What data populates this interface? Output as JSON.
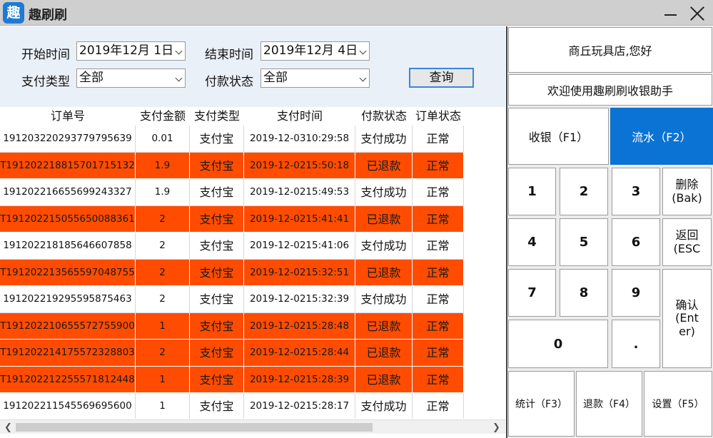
{
  "window": {
    "logo": "趣",
    "title": "趣刷刷"
  },
  "filters": {
    "start_label": "开始时间",
    "start_value": "2019年12月  1日",
    "end_label": "结束时间",
    "end_value": "2019年12月  4日",
    "paytype_label": "支付类型",
    "paytype_value": "全部",
    "paystatus_label": "付款状态",
    "paystatus_value": "全部",
    "query_label": "查询"
  },
  "table": {
    "headers": [
      "订单号",
      "支付金额",
      "支付类型",
      "支付时间",
      "付款状态",
      "订单状态"
    ],
    "rows": [
      {
        "id": "1912032202937797956​39",
        "amount": "0.01",
        "type": "支付宝",
        "time": "2019-12-03 10:29:58",
        "paystatus": "支付成功",
        "orderstatus": "正常",
        "refund": false
      },
      {
        "id": "T19120221881570171513 2",
        "amount": "1.9",
        "type": "支付宝",
        "time": "2019-12-02 15:50:18",
        "paystatus": "已退款",
        "orderstatus": "正常",
        "refund": true
      },
      {
        "id": "1912022166556992433 27",
        "amount": "1.9",
        "type": "支付宝",
        "time": "2019-12-02 15:49:53",
        "paystatus": "支付成功",
        "orderstatus": "正常",
        "refund": false
      },
      {
        "id": "T19120221505565008836 1",
        "amount": "2",
        "type": "支付宝",
        "time": "2019-12-02 15:41:41",
        "paystatus": "已退款",
        "orderstatus": "正常",
        "refund": true
      },
      {
        "id": "1912022181856466078 58",
        "amount": "2",
        "type": "支付宝",
        "time": "2019-12-02 15:41:06",
        "paystatus": "支付成功",
        "orderstatus": "正常",
        "refund": false
      },
      {
        "id": "T19120221356559704875 5",
        "amount": "2",
        "type": "支付宝",
        "time": "2019-12-02 15:32:51",
        "paystatus": "已退款",
        "orderstatus": "正常",
        "refund": true
      },
      {
        "id": "1912022192955958754 63",
        "amount": "2",
        "type": "支付宝",
        "time": "2019-12-02 15:32:39",
        "paystatus": "支付成功",
        "orderstatus": "正常",
        "refund": false
      },
      {
        "id": "T19120221065557275590 0",
        "amount": "1",
        "type": "支付宝",
        "time": "2019-12-02 15:28:48",
        "paystatus": "已退款",
        "orderstatus": "正常",
        "refund": true
      },
      {
        "id": "T19120221417557232880 3",
        "amount": "2",
        "type": "支付宝",
        "time": "2019-12-02 15:28:44",
        "paystatus": "已退款",
        "orderstatus": "正常",
        "refund": true
      },
      {
        "id": "T19120221225557181244 8",
        "amount": "1",
        "type": "支付宝",
        "time": "2019-12-02 15:28:39",
        "paystatus": "已退款",
        "orderstatus": "正常",
        "refund": true
      },
      {
        "id": "1912022115455696956 00",
        "amount": "1",
        "type": "支付宝",
        "time": "2019-12-02 15:28:17",
        "paystatus": "支付成功",
        "orderstatus": "正常",
        "refund": false
      }
    ]
  },
  "panel": {
    "greeting": "商丘玩具店,您好",
    "welcome": "欢迎使用趣刷刷收银助手",
    "tab_cashier": "收银（F1）",
    "tab_flow": "流水（F2）",
    "keys": [
      "1",
      "2",
      "3",
      "4",
      "5",
      "6",
      "7",
      "8",
      "9",
      "0",
      "."
    ],
    "delete_key": "删除\n(Bak)",
    "back_key": "返回\n(ESC",
    "confirm_key": "确认\n(Ent\ner)",
    "stats_btn": "统计（F3）",
    "refund_btn": "退款（F4）",
    "settings_btn": "设置（F5）"
  },
  "colors": {
    "refund_row": "#ff4c00",
    "accent": "#0a73d3",
    "filter_bg": "#eaf0f8"
  }
}
